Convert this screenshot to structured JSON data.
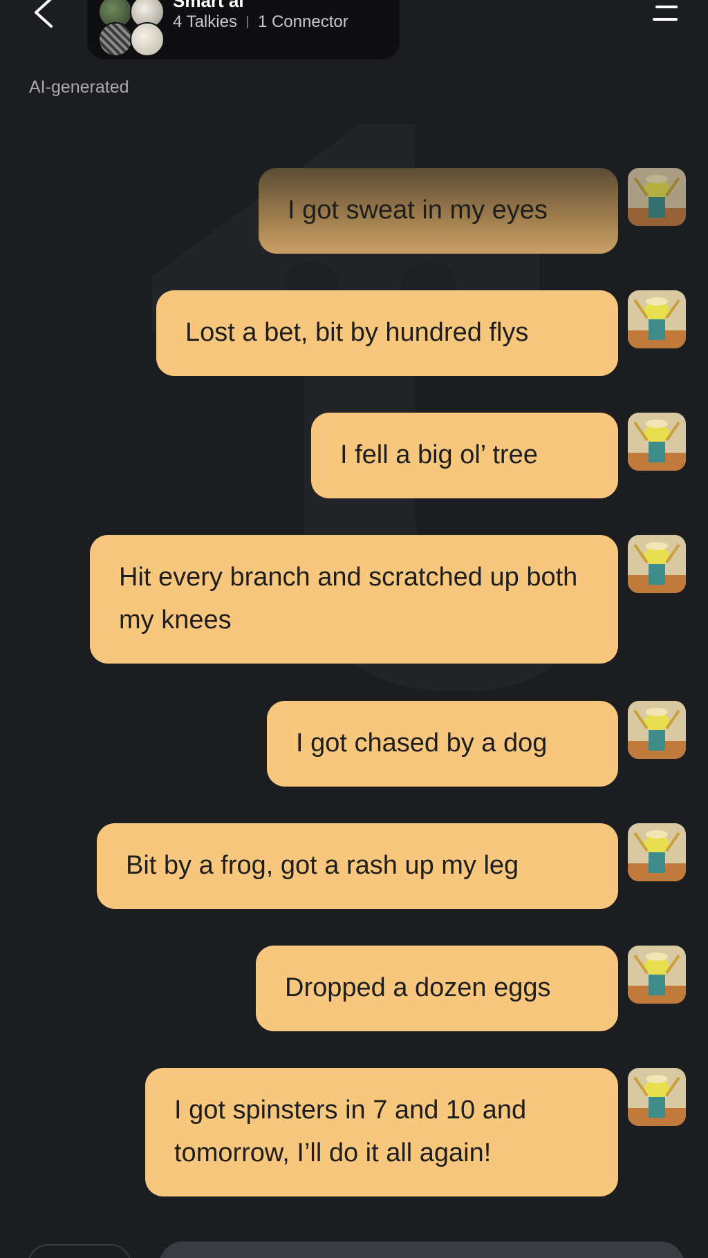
{
  "header": {
    "title": "Smart ai",
    "talkies": "4 Talkies",
    "connector": "1 Connector",
    "back_icon": "chevron-left-icon",
    "menu_icon": "menu-icon"
  },
  "ai_label": "AI-generated",
  "colors": {
    "background": "#1c1d21",
    "bubble": "#f8c77e",
    "bubble_text": "#1e1e1e",
    "header_pill": "#0f0f12"
  },
  "messages": [
    {
      "text": "I got sweat in my eyes"
    },
    {
      "text": "Lost a bet, bit by hundred flys"
    },
    {
      "text": "I fell a big ol’ tree"
    },
    {
      "text": "Hit every branch and scratched up both my knees"
    },
    {
      "text": "I got chased by a dog"
    },
    {
      "text": "Bit by a frog, got a rash up my leg"
    },
    {
      "text": "Dropped a dozen eggs"
    },
    {
      "text": "I got spinsters in 7 and 10 and tomorrow, I’ll do it all again!"
    }
  ]
}
